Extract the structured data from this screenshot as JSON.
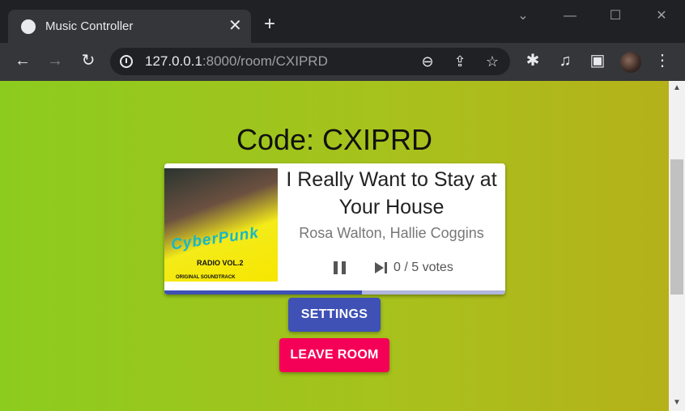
{
  "browser": {
    "tab_title": "Music Controller",
    "url_host": "127.0.0.1",
    "url_rest": ":8000/room/CXIPRD",
    "icons": [
      "globe-icon",
      "close-icon",
      "plus-icon",
      "chevron-down-icon",
      "minimize-icon",
      "maximize-icon",
      "window-close-icon",
      "back-icon",
      "forward-icon",
      "reload-icon",
      "info-icon",
      "zoom-out-icon",
      "share-icon",
      "star-icon",
      "extensions-icon",
      "media-icon",
      "sidebar-icon",
      "profile-avatar",
      "menu-icon"
    ]
  },
  "room": {
    "code_text": "Code: CXIPRD"
  },
  "player": {
    "song_title": "I Really Want to Stay at Your House",
    "artist": "Rosa Walton, Hallie Coggins",
    "votes": "0 / 5 votes",
    "progress": 0.58,
    "cover": {
      "logo": "CyberPunk",
      "radio": "RADIO VOL.2",
      "ost": "ORIGINAL SOUNDTRACK"
    }
  },
  "buttons": {
    "settings": "SETTINGS",
    "leave": "LEAVE ROOM"
  },
  "colors": {
    "primary": "#3f51b5",
    "secondary": "#f50057"
  }
}
